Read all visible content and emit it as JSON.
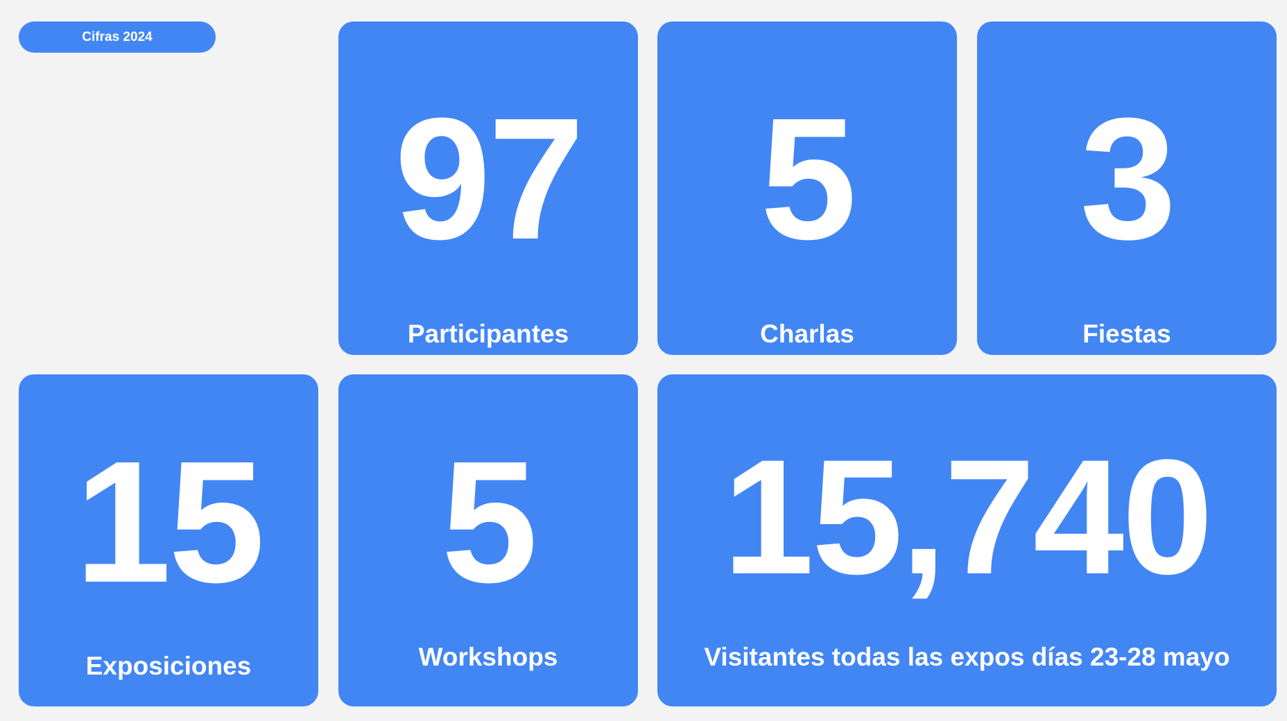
{
  "header": {
    "tag_label": "Cifras 2024"
  },
  "colors": {
    "background": "#f3f3f4",
    "card": "#4286f4",
    "text": "#ffffff"
  },
  "stats": {
    "participantes": {
      "value": "97",
      "label": "Participantes"
    },
    "charlas": {
      "value": "5",
      "label": "Charlas"
    },
    "fiestas": {
      "value": "3",
      "label": "Fiestas"
    },
    "exposiciones": {
      "value": "15",
      "label": "Exposiciones"
    },
    "workshops": {
      "value": "5",
      "label": "Workshops"
    },
    "visitantes": {
      "value": "15,740",
      "label": "Visitantes todas las expos días 23-28 mayo"
    }
  }
}
